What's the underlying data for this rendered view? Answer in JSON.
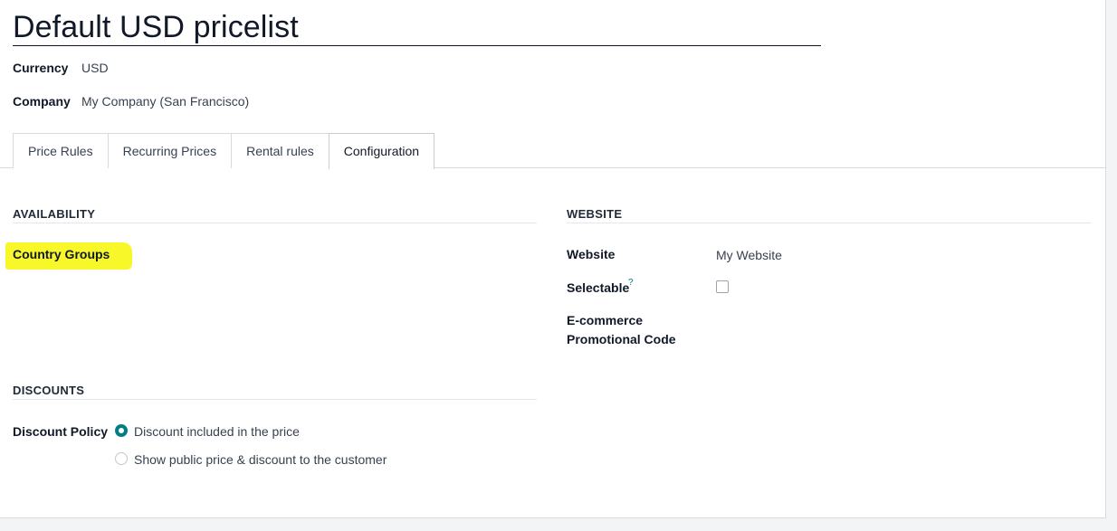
{
  "record": {
    "title": "Default USD pricelist",
    "currency_label": "Currency",
    "currency_value": "USD",
    "company_label": "Company",
    "company_value": "My Company (San Francisco)"
  },
  "tabs": [
    {
      "label": "Price Rules",
      "active": false
    },
    {
      "label": "Recurring Prices",
      "active": false
    },
    {
      "label": "Rental rules",
      "active": false
    },
    {
      "label": "Configuration",
      "active": true
    }
  ],
  "availability": {
    "section_title": "AVAILABILITY",
    "country_groups_label": "Country Groups",
    "highlight_color": "#f7f72a"
  },
  "website": {
    "section_title": "WEBSITE",
    "website_label": "Website",
    "website_value": "My Website",
    "selectable_label": "Selectable",
    "selectable_help": "?",
    "selectable_checked": false,
    "promo_label_line1": "E-commerce",
    "promo_label_line2": "Promotional Code"
  },
  "discounts": {
    "section_title": "DISCOUNTS",
    "policy_label": "Discount Policy",
    "options": [
      {
        "label": "Discount included in the price",
        "selected": true
      },
      {
        "label": "Show public price & discount to the customer",
        "selected": false
      }
    ]
  },
  "colors": {
    "accent": "#017e84"
  }
}
